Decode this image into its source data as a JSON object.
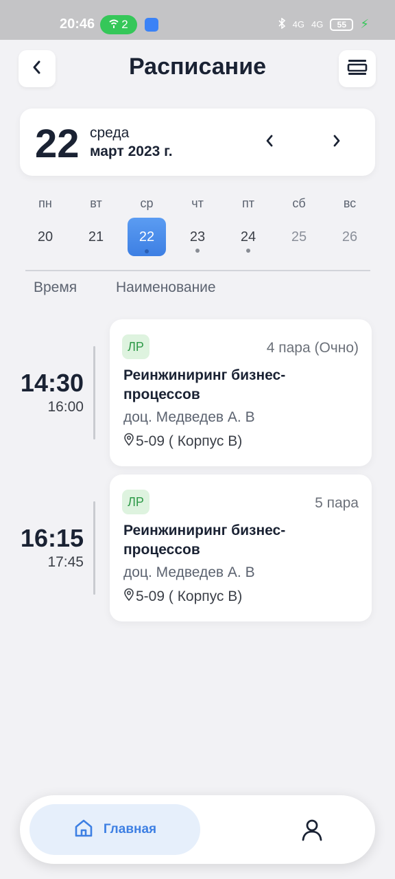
{
  "status_bar": {
    "time": "20:46",
    "hotspot_count": "2",
    "network_1": "4G",
    "network_2": "4G",
    "battery": "55"
  },
  "header": {
    "title": "Расписание",
    "back_icon": "chevron-left-icon",
    "menu_icon": "view-list-icon"
  },
  "date_card": {
    "day": "22",
    "weekday": "среда",
    "month_year": "март 2023 г."
  },
  "week": {
    "labels": [
      "пн",
      "вт",
      "ср",
      "чт",
      "пт",
      "сб",
      "вс"
    ],
    "days": [
      "20",
      "21",
      "22",
      "23",
      "24",
      "25",
      "26"
    ],
    "selected_index": 2
  },
  "columns": {
    "time": "Время",
    "name": "Наименование"
  },
  "lessons": [
    {
      "start": "14:30",
      "end": "16:00",
      "type": "ЛР",
      "pair": "4 пара (Очно)",
      "subject": "Реинжиниринг бизнес-процессов",
      "teacher": "доц. Медведев А. В",
      "room": "5-09 ( Корпус В)"
    },
    {
      "start": "16:15",
      "end": "17:45",
      "type": "ЛР",
      "pair": "5 пара",
      "subject": "Реинжиниринг бизнес-процессов",
      "teacher": "доц. Медведев А. В",
      "room": "5-09 ( Корпус В)"
    }
  ],
  "bottom_nav": {
    "home_label": "Главная",
    "home_icon": "home-icon",
    "profile_icon": "user-icon"
  },
  "colors": {
    "accent": "#3d7fe3",
    "badge_bg": "#def3df",
    "badge_text": "#2e9a48"
  }
}
